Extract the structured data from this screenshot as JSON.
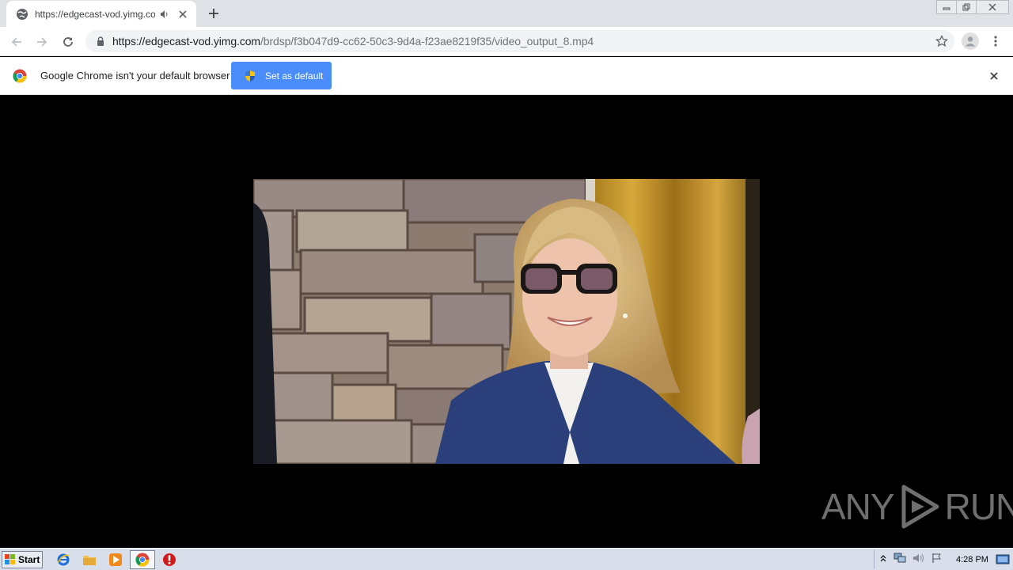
{
  "browser": {
    "tab": {
      "title": "https://edgecast-vod.yimg.com/brdsp/f3b047d9-cc62-50c3-9d4a-f23ae8219f35/video_output_8.mp4"
    },
    "url": {
      "host": "https://edgecast-vod.yimg.com",
      "path": "/brdsp/f3b047d9-cc62-50c3-9d4a-f23ae8219f35/video_output_8.mp4"
    }
  },
  "infobar": {
    "message": "Google Chrome isn't your default browser",
    "button_label": "Set as default"
  },
  "watermark": {
    "left": "ANY",
    "right": "RUN"
  },
  "taskbar": {
    "start_label": "Start",
    "clock": "4:28 PM"
  },
  "colors": {
    "accent_button": "#4b8df8",
    "tabstrip": "#dee1e6",
    "taskbar": "#d8dfeb"
  }
}
